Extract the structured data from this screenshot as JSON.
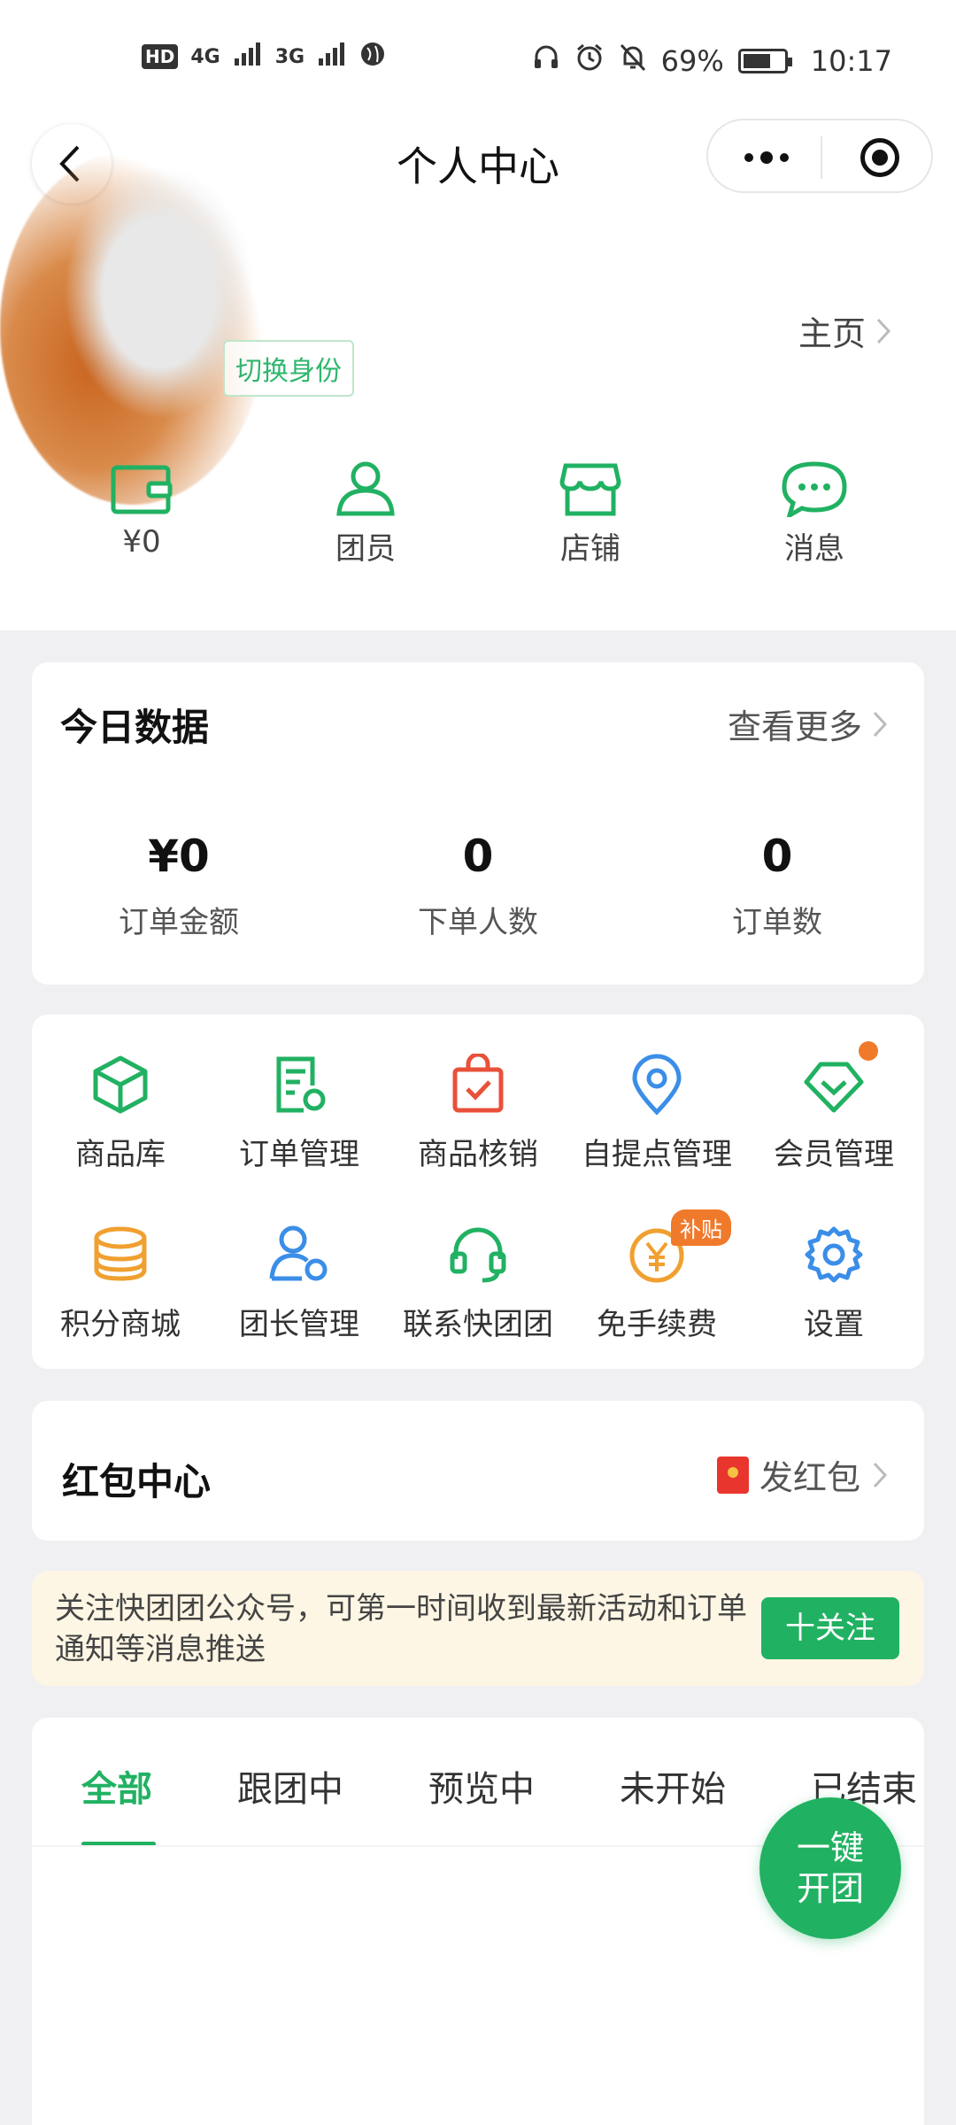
{
  "status_bar": {
    "network_left": [
      "HD",
      "4G",
      "3G"
    ],
    "battery": "69%",
    "time": "10:17",
    "battery_level": 0.69
  },
  "nav": {
    "title": "个人中心"
  },
  "profile": {
    "switch_identity": "切换身份",
    "home_link": "主页"
  },
  "quick_actions": [
    {
      "label": "¥0",
      "icon": "wallet-icon"
    },
    {
      "label": "团员",
      "icon": "member-icon"
    },
    {
      "label": "店铺",
      "icon": "shop-icon"
    },
    {
      "label": "消息",
      "icon": "message-icon"
    }
  ],
  "today": {
    "title": "今日数据",
    "more": "查看更多",
    "stats": [
      {
        "value": "¥0",
        "label": "订单金额"
      },
      {
        "value": "0",
        "label": "下单人数"
      },
      {
        "value": "0",
        "label": "订单数"
      }
    ]
  },
  "tools": [
    {
      "label": "商品库",
      "icon": "cube-icon",
      "color": "#21b162"
    },
    {
      "label": "订单管理",
      "icon": "order-icon",
      "color": "#21b162"
    },
    {
      "label": "商品核销",
      "icon": "bag-check-icon",
      "color": "#e8503a"
    },
    {
      "label": "自提点管理",
      "icon": "location-icon",
      "color": "#3b8ee8"
    },
    {
      "label": "会员管理",
      "icon": "diamond-icon",
      "color": "#21b162"
    },
    {
      "label": "积分商城",
      "icon": "coins-icon",
      "color": "#f0a030"
    },
    {
      "label": "团长管理",
      "icon": "leader-icon",
      "color": "#3b8ee8"
    },
    {
      "label": "联系快团团",
      "icon": "headset-icon",
      "color": "#21b162"
    },
    {
      "label": "免手续费",
      "icon": "yen-coin-icon",
      "color": "#f0a030"
    },
    {
      "label": "设置",
      "icon": "gear-icon",
      "color": "#3b8ee8"
    }
  ],
  "subsidy_badge": "补贴",
  "red_packet": {
    "title": "红包中心",
    "action": "发红包"
  },
  "notice": {
    "text": "关注快团团公众号，可第一时间收到最新活动和订单通知等消息推送",
    "button": "十关注"
  },
  "tabs": [
    "全部",
    "跟团中",
    "预览中",
    "未开始",
    "已结束"
  ],
  "active_tab": 0,
  "fab": {
    "line1": "一键",
    "line2": "开团"
  },
  "colors": {
    "primary": "#21b162",
    "accent": "#f07a2b",
    "text": "#222222"
  }
}
